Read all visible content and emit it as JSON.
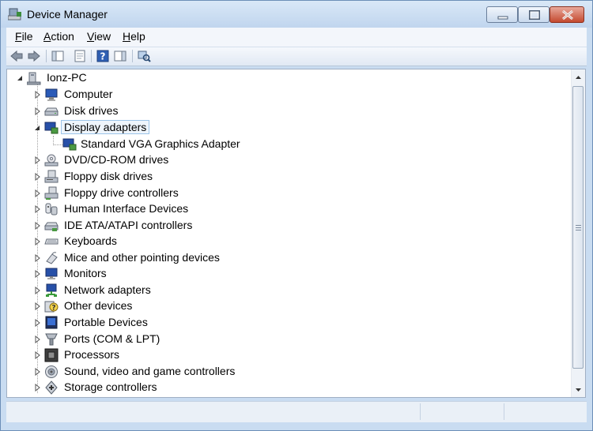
{
  "window": {
    "title": "Device Manager",
    "controls": [
      "minimize",
      "maximize",
      "close"
    ]
  },
  "menu": [
    {
      "accel": "F",
      "rest": "ile"
    },
    {
      "accel": "A",
      "rest": "ction"
    },
    {
      "accel": "V",
      "rest": "iew"
    },
    {
      "accel": "H",
      "rest": "elp"
    }
  ],
  "toolbar": {
    "icons": [
      "back-arrow-icon",
      "forward-arrow-icon",
      "show-hide-console-tree-icon",
      "properties-icon",
      "help-icon",
      "action-pane-icon",
      "scan-hardware-icon"
    ]
  },
  "tree": {
    "root": {
      "label": "Ionz-PC",
      "icon": "computer-icon",
      "expanded": true
    },
    "items": [
      {
        "label": "Computer",
        "icon": "computer-icon",
        "expanded": false
      },
      {
        "label": "Disk drives",
        "icon": "disk-drive-icon",
        "expanded": false
      },
      {
        "label": "Display adapters",
        "icon": "display-adapter-icon",
        "expanded": true,
        "selected": true
      },
      {
        "label": "Standard VGA Graphics Adapter",
        "icon": "display-adapter-icon",
        "child": true
      },
      {
        "label": "DVD/CD-ROM drives",
        "icon": "dvd-drive-icon",
        "expanded": false
      },
      {
        "label": "Floppy disk drives",
        "icon": "floppy-disk-icon",
        "expanded": false
      },
      {
        "label": "Floppy drive controllers",
        "icon": "floppy-controller-icon",
        "expanded": false
      },
      {
        "label": "Human Interface Devices",
        "icon": "hid-icon",
        "expanded": false
      },
      {
        "label": "IDE ATA/ATAPI controllers",
        "icon": "ide-controller-icon",
        "expanded": false
      },
      {
        "label": "Keyboards",
        "icon": "keyboard-icon",
        "expanded": false
      },
      {
        "label": "Mice and other pointing devices",
        "icon": "mouse-icon",
        "expanded": false
      },
      {
        "label": "Monitors",
        "icon": "monitor-icon",
        "expanded": false
      },
      {
        "label": "Network adapters",
        "icon": "network-adapter-icon",
        "expanded": false
      },
      {
        "label": "Other devices",
        "icon": "other-devices-icon",
        "expanded": false
      },
      {
        "label": "Portable Devices",
        "icon": "portable-device-icon",
        "expanded": false
      },
      {
        "label": "Ports (COM & LPT)",
        "icon": "port-icon",
        "expanded": false
      },
      {
        "label": "Processors",
        "icon": "processor-icon",
        "expanded": false
      },
      {
        "label": "Sound, video and game controllers",
        "icon": "sound-icon",
        "expanded": false
      },
      {
        "label": "Storage controllers",
        "icon": "storage-controller-icon",
        "expanded": false
      }
    ]
  },
  "colors": {
    "frame": "#c9dcf1",
    "selection_border": "#9cc4e8",
    "close_button": "#c44a2f"
  }
}
